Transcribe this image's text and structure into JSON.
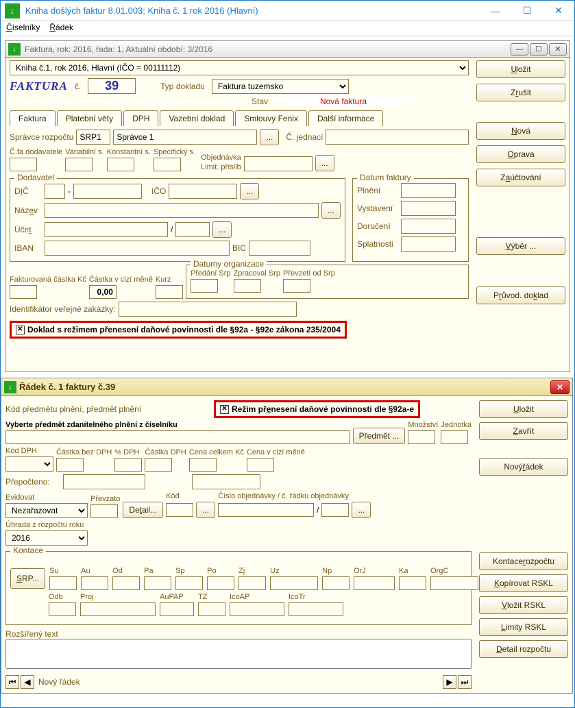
{
  "main_window": {
    "title": "Kniha došlých faktur 8.01.003; Kniha č. 1 rok 2016  (Hlavní)",
    "icon_glyph": "↓",
    "menu": {
      "ciselniky": "Číselníky",
      "radek": "Řádek"
    }
  },
  "invoice_window": {
    "title": "Faktura, rok: 2016, řada: 1, Aktuální období: 3/2016",
    "icon_glyph": "↓",
    "book_select": "Kniha č.1, rok 2016, Hlavní  (IČO = 00111112)",
    "buttons": {
      "ulozit": "Uložit",
      "zrusit": "Zrušit",
      "nova": "Nová",
      "oprava": "Oprava",
      "zauctovani": "Zaúčtování",
      "vyber": "Výběr ...",
      "pruvod": "Průvod. doklad"
    },
    "header": {
      "word": "FAKTURA",
      "c_label": "č.",
      "number": "39",
      "typ_label": "Typ dokladu",
      "typ_value": "Faktura tuzemsko",
      "stav_label": "Stav",
      "stav_value": "Nová faktura"
    },
    "tabs": {
      "faktura": "Faktura",
      "platebni": "Platební věty",
      "dph": "DPH",
      "vazebni": "Vazební doklad",
      "smlouvy": "Smlouvy Fenix",
      "dalsi": "Další informace"
    },
    "fields": {
      "spravce_label": "Správce rozpočtu",
      "spravce_code": "SRP1",
      "spravce_name": "Správce 1",
      "cjednaci_label": "Č. jednací",
      "cfadod_label": "Č.fa dodavatele",
      "varsym_label": "Variabilní s.",
      "konsts_label": "Konstantní s.",
      "specs_label": "Specifický s.",
      "objednavka_label1": "Objednávka",
      "objednavka_label2": "Limit. příslib",
      "dodavatel_title": "Dodavatel",
      "dic_label": "DIČ",
      "dic_dash": "-",
      "ico_label": "IČO",
      "nazev_label": "Název",
      "ucet_label": "Účet",
      "ucet_slash": "/",
      "iban_label": "IBAN",
      "bic_label": "BIC",
      "datumy_title": "Datum faktury",
      "plneni_label": "Plnění",
      "vystaveni_label": "Vystavení",
      "doruceni_label": "Doručení",
      "splatnosti_label": "Splatnosti",
      "fakt_castka_label": "Fakturovaná částka Kč",
      "castka_cizi_label": "Částka v cizí měně",
      "castka_cizi_val": "0,00",
      "kurz_label": "Kurz",
      "datorg_title": "Datumy organizace",
      "predani_label": "Předání Srp",
      "zpracoval_label": "Zpracoval Srp",
      "prevzeti_label": "Převzetí od Srp",
      "idvz_label": "Identifikátor veřejné zakázky:"
    },
    "red_check": "Doklad s režimem přenesení daňové povinnosti dle §92a - §92e zákona 235/2004"
  },
  "line_window": {
    "title": "Řádek č. 1 faktury č.39",
    "icon_glyph": "↓",
    "buttons": {
      "ulozit": "Uložit",
      "zavrit": "Zavřít",
      "novy_radek": "Nový řádek",
      "kontace": "Kontace rozpočtu",
      "kopirovat": "Kopírovat RSKL",
      "vlozit": "Vložit RSKL",
      "limity": "Limity RSKL",
      "detail_r": "Detail rozpočtu"
    },
    "fields": {
      "kpp_label": "Kód předmětu plnění, předmět plnění",
      "red_label": "Režim přenesení daňové povinnosti dle §92a-e",
      "vyberte_label": "Vyberte předmět zdanitelného plnění z číselníku",
      "predmet_btn": "Předmět ...",
      "mnozstvi_label": "Množství",
      "jednotka_label": "Jednotka",
      "koddph_label": "Kód DPH",
      "castkabez_label": "Částka bez  DPH",
      "pctdph_label": "% DPH",
      "castkadph_label": "Částka DPH",
      "cenac_label": "Cena celkem Kč",
      "cenacizi_label": "Cena v cizí měně",
      "prepocteno_label": "Přepočteno:",
      "evidovat_label": "Evidovat",
      "evidovat_val": "Nezařazovat",
      "prevzato_label": "Převzato",
      "detail_btn": "Detail...",
      "kod_label": "Kód",
      "cisloobj_label": "Číslo objednávky / č. řádku objednávky",
      "uhrada_label": "Úhrada z rozpočtu roku",
      "uhrada_val": "2016",
      "rozsir_label": "Rozšířený text",
      "kontace_title": "Kontace",
      "srp_btn": "SRP...",
      "k": {
        "su": "Su",
        "au": "Au",
        "od": "Od",
        "pa": "Pa",
        "sp": "Sp",
        "po": "Po",
        "zj": "Zj",
        "uz": "Uz",
        "np": "Np",
        "orj": "OrJ",
        "ka": "Ka",
        "orgc": "OrgC",
        "odb": "Odb",
        "proj": "Proj",
        "aupap": "AuPAP",
        "tz": "TZ",
        "icoap": "IcoAP",
        "icotr": "IcoTr"
      },
      "nav_status": "Nový řádek"
    }
  }
}
